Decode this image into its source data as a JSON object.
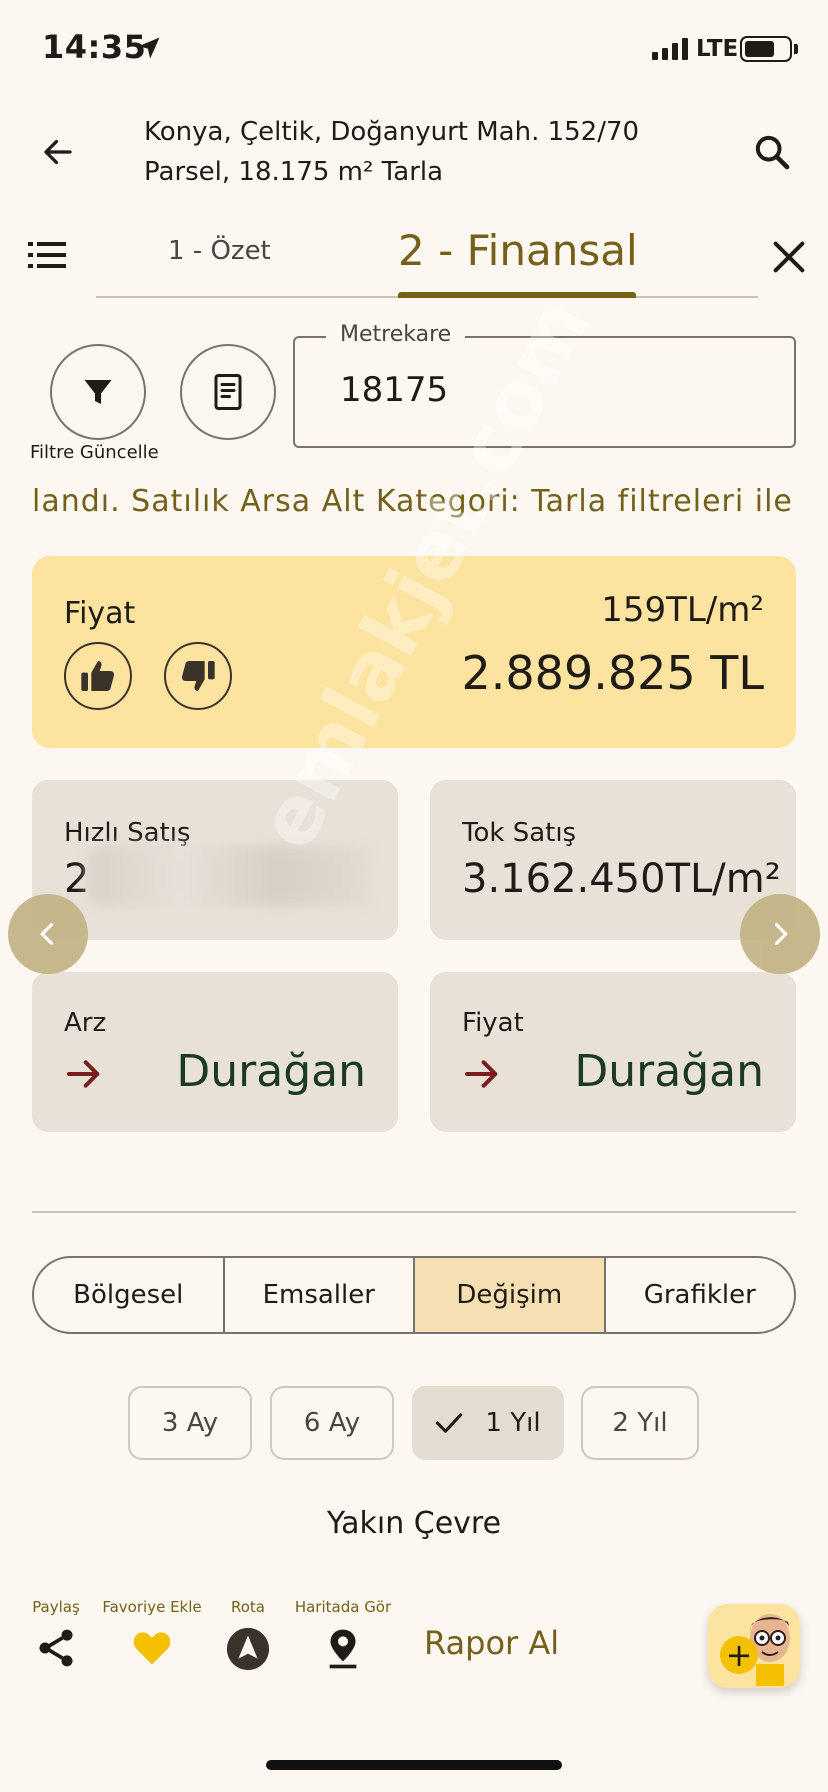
{
  "status_bar": {
    "time": "14:35",
    "network": "LTE"
  },
  "header": {
    "title": "Konya, Çeltik, Doğanyurt Mah. 152/70 Parsel, 18.175 m² Tarla"
  },
  "tabs": [
    {
      "label": "1 - Özet"
    },
    {
      "label": "2 - Finansal"
    }
  ],
  "filter": {
    "filter_button_label": "Filtre Güncelle",
    "metrekare_label": "Metrekare",
    "metrekare_value": "18175"
  },
  "marquee_text": "landı. Satılık Arsa Alt Kategori: Tarla filtreleri ile he",
  "price_card": {
    "title": "Fiyat",
    "per_m2": "159TL/m²",
    "total": "2.889.825 TL"
  },
  "stats": {
    "hizli_satis": {
      "label": "Hızlı Satış",
      "value": "2"
    },
    "tok_satis": {
      "label": "Tok Satış",
      "value": "3.162.450TL/m²"
    },
    "arz": {
      "label": "Arz",
      "trend": "Durağan"
    },
    "fiyat": {
      "label": "Fiyat",
      "trend": "Durağan"
    }
  },
  "watermark": "emlakjet.com",
  "segments": [
    {
      "label": "Bölgesel"
    },
    {
      "label": "Emsaller"
    },
    {
      "label": "Değişim"
    },
    {
      "label": "Grafikler"
    }
  ],
  "periods": [
    {
      "label": "3 Ay"
    },
    {
      "label": "6 Ay"
    },
    {
      "label": "1 Yıl"
    },
    {
      "label": "2 Yıl"
    }
  ],
  "section_title": "Yakın Çevre",
  "bottom_bar": {
    "share_label": "Paylaş",
    "favorite_label": "Favoriye Ekle",
    "route_label": "Rota",
    "map_label": "Haritada Gör",
    "report_label": "Rapor Al"
  },
  "colors": {
    "accent": "#75601a",
    "price_card_bg": "#fde3a0",
    "stat_card_bg": "#e8e1d8",
    "active_segment": "#f6dfb3",
    "trend_arrow": "#7a1d1d",
    "favorite": "#f5c000"
  },
  "icons": [
    "location-arrow-icon",
    "back-arrow-icon",
    "search-icon",
    "menu-list-icon",
    "close-icon",
    "filter-icon",
    "document-icon",
    "thumbs-up-icon",
    "thumbs-down-icon",
    "chevron-left-icon",
    "chevron-right-icon",
    "trend-arrow-right-icon",
    "checkmark-icon",
    "share-icon",
    "heart-icon",
    "navigation-icon",
    "map-pin-icon",
    "assistant-avatar-icon"
  ]
}
